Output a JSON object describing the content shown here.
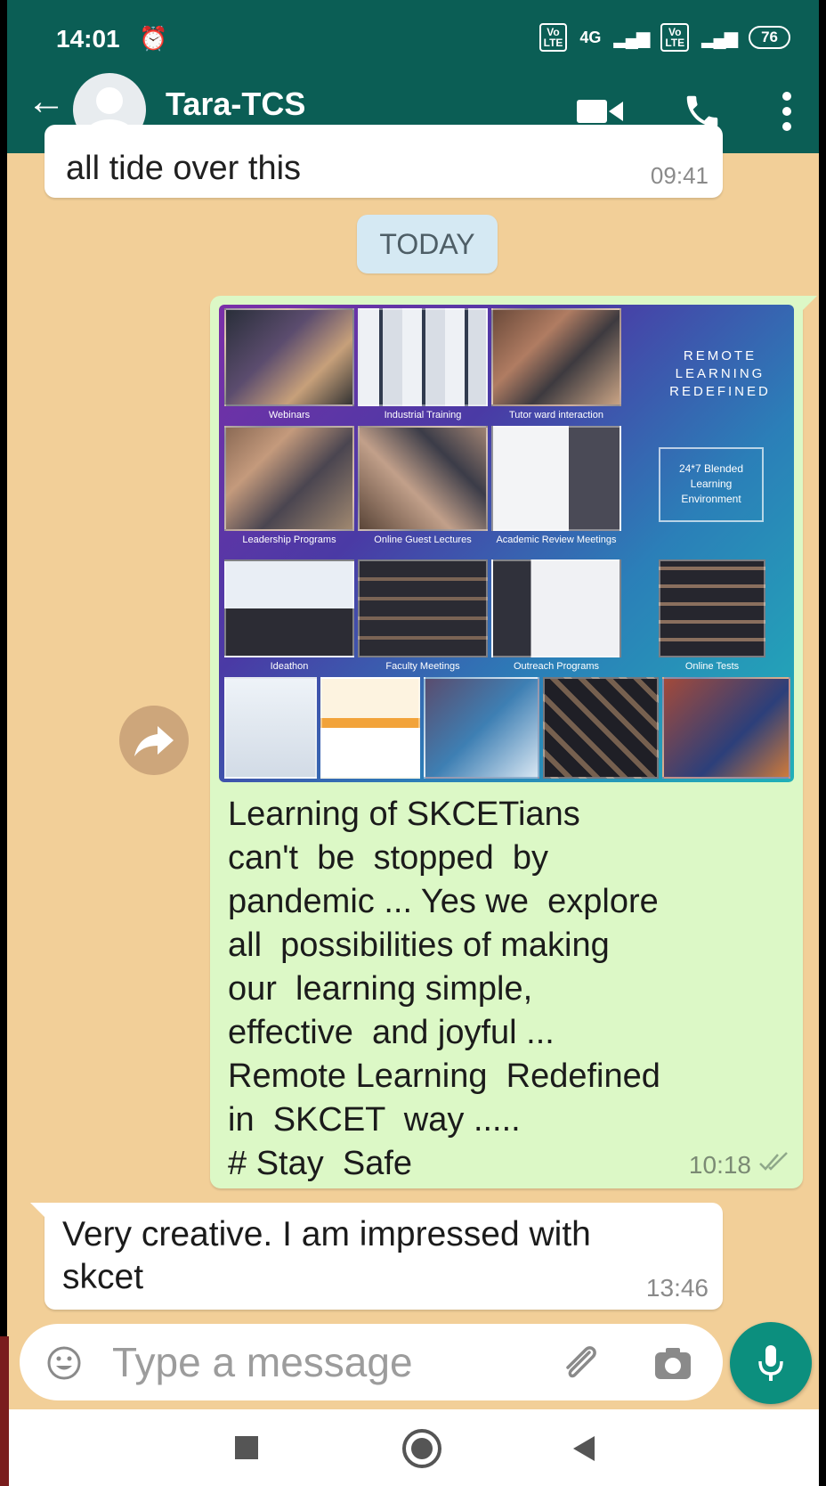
{
  "status_bar": {
    "time": "14:01",
    "network": "4G",
    "battery": "76"
  },
  "app_bar": {
    "contact_name": "Tara-TCS"
  },
  "messages": [
    {
      "direction": "in",
      "text": "all tide over this",
      "time": "09:41"
    },
    {
      "direction": "out",
      "image_captions": [
        "Webinars",
        "Industrial Training",
        "Tutor ward interaction",
        "Leadership Programs",
        "Online Guest Lectures",
        "Academic Review Meetings",
        "Ideathon",
        "Faculty Meetings",
        "Outreach Programs",
        "Online Tests"
      ],
      "image_brand": "REMOTE LEARNING REDEFINED",
      "image_box": "24*7 Blended Learning Environment",
      "text": "Learning of SKCETians\ncan't  be  stopped  by\npandemic ... Yes we  explore\nall  possibilities of making\nour  learning simple,\neffective  and joyful ...\nRemote Learning  Redefined\nin  SKCET  way .....\n# Stay  Safe",
      "time": "10:18"
    },
    {
      "direction": "in",
      "text": "Very creative.  I am impressed with skcet",
      "time": "13:46"
    }
  ],
  "day_separator": "TODAY",
  "composer": {
    "placeholder": "Type a message"
  },
  "colors": {
    "header": "#0b5e55",
    "wallpaper": "#f2cf98",
    "outgoing": "#dcf8c6",
    "accent": "#0c8f7e"
  }
}
